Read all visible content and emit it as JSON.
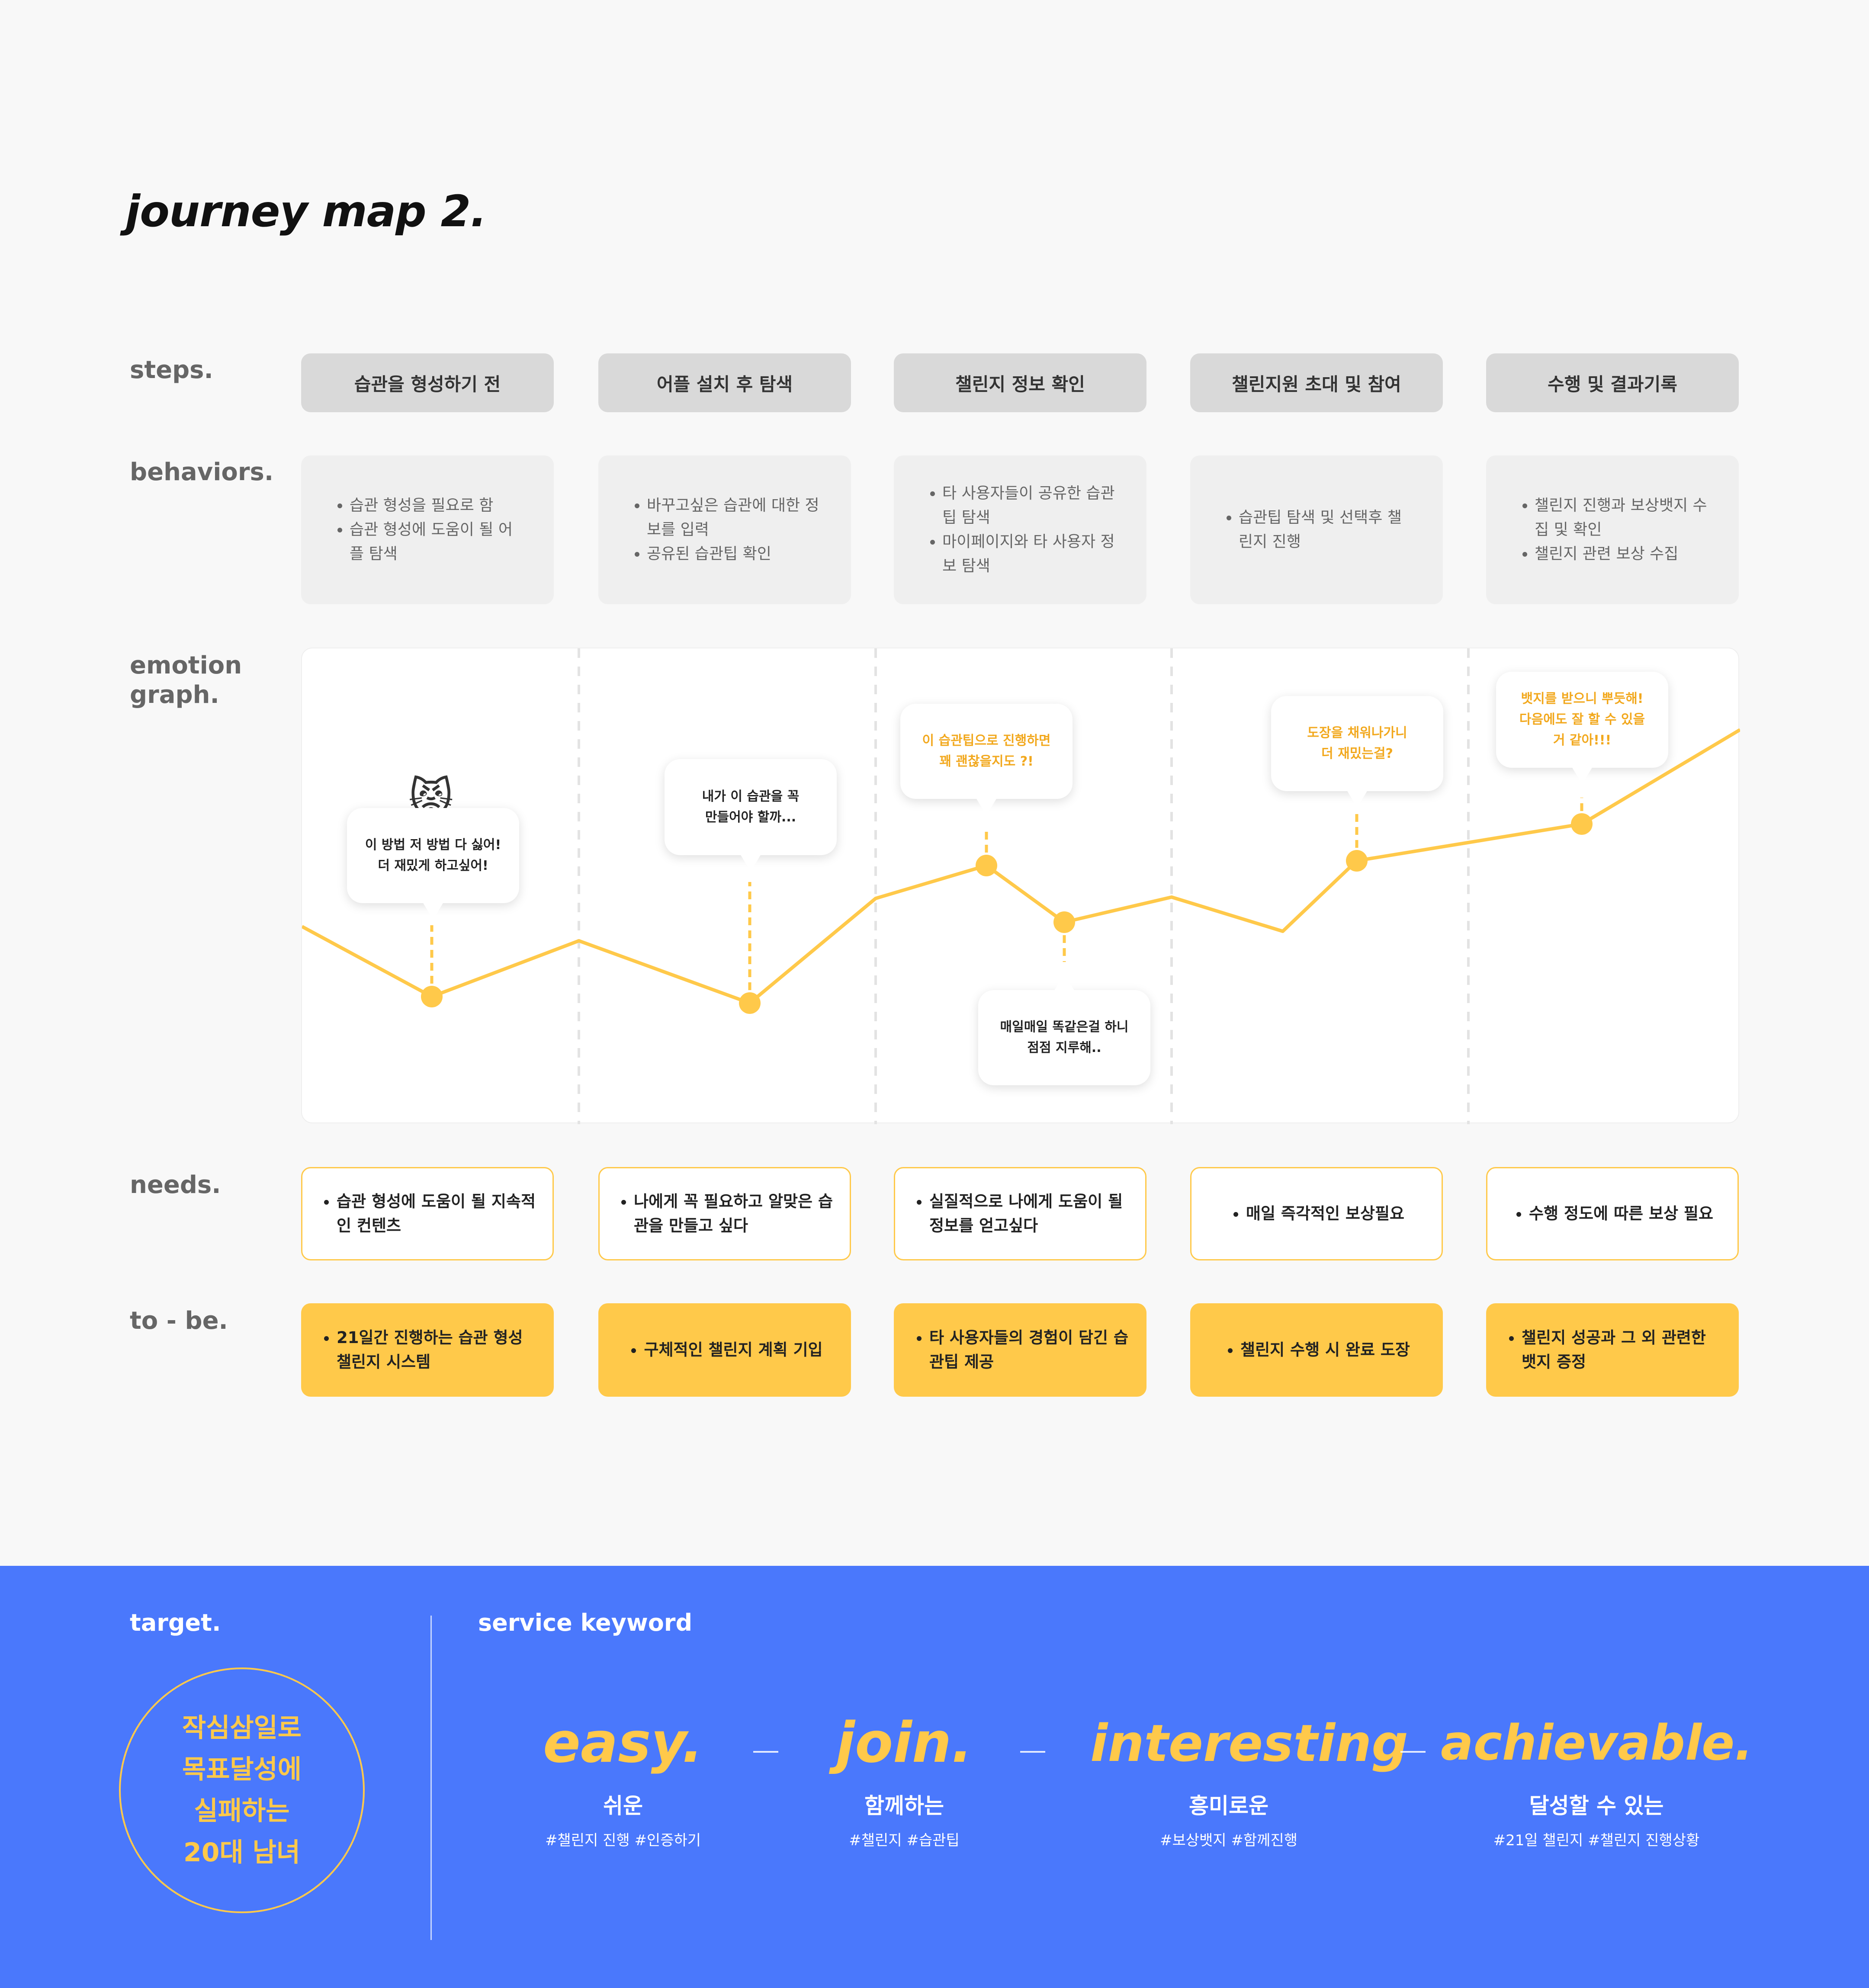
{
  "title": "journey map 2.",
  "row_labels": {
    "steps": "steps.",
    "behaviors": "behaviors.",
    "emotion_line1": "emotion",
    "emotion_line2": "graph.",
    "needs": "needs.",
    "tobe": "to - be."
  },
  "steps": [
    "습관을 형성하기 전",
    "어플 설치 후 탐색",
    "챌린지 정보 확인",
    "챌린지원 초대 및 참여",
    "수행 및 결과기록"
  ],
  "behaviors": [
    [
      "습관 형성을 필요로 함",
      "습관 형성에 도움이 될 어플 탐색"
    ],
    [
      "바꾸고싶은 습관에 대한 정보를 입력",
      "공유된 습관팁 확인"
    ],
    [
      "타 사용자들이 공유한 습관팁 탐색",
      "마이페이지와 타 사용자 정보 탐색"
    ],
    [
      "습관팁 탐색 및 선택후 챌린지 진행"
    ],
    [
      "챌린지 진행과 보상뱃지 수집 및 확인",
      "챌린지 관련 보상 수집"
    ]
  ],
  "emotion": {
    "line_color": "#ffc94a",
    "emoji": "😾",
    "bubbles": [
      "이 방법 저 방법 다 싫어!\n더 재밌게 하고싶어!",
      "내가 이 습관을 꼭\n만들어야 할까...",
      "이 습관팁으로 진행하면\n꽤 괜찮을지도 ?!",
      "매일매일 똑같은걸 하니\n점점 지루해..",
      "도장을 채워나가니\n더 재밌는걸?",
      "뱃지를 받으니 뿌듯해!\n다음에도 잘 할 수 있을\n거 같아!!!"
    ]
  },
  "needs": [
    [
      "습관 형성에 도움이 될 지속적인 컨텐츠"
    ],
    [
      "나에게 꼭 필요하고 알맞은 습관을 만들고 싶다"
    ],
    [
      "실질적으로 나에게 도움이 될 정보를 얻고싶다"
    ],
    [
      "매일 즉각적인 보상필요"
    ],
    [
      "수행 정도에 따른 보상 필요"
    ]
  ],
  "tobe": [
    [
      "21일간 진행하는 습관 형성 챌린지 시스템"
    ],
    [
      "구체적인 챌린지 계획 기입"
    ],
    [
      "타 사용자들의 경험이 담긴 습관팁 제공"
    ],
    [
      "챌린지 수행 시 완료 도장"
    ],
    [
      "챌린지 성공과 그 외 관련한 뱃지 증정"
    ]
  ],
  "footer": {
    "target_label": "target.",
    "target_text": "작심삼일로\n목표달성에\n실패하는\n20대 남녀",
    "keyword_label": "service keyword",
    "keywords": [
      {
        "en": "easy.",
        "ko": "쉬운",
        "tags": "#챌린지 진행  #인증하기"
      },
      {
        "en": "join.",
        "ko": "함께하는",
        "tags": "#챌린지  #습관팁"
      },
      {
        "en": "interesting",
        "ko": "흥미로운",
        "tags": "#보상뱃지  #함께진행"
      },
      {
        "en": "achievable.",
        "ko": "달성할 수 있는",
        "tags": "#21일 챌린지  #챌린지 진행상황"
      }
    ],
    "colors": {
      "background": "#4a78fc",
      "accent": "#ffc94a"
    }
  }
}
